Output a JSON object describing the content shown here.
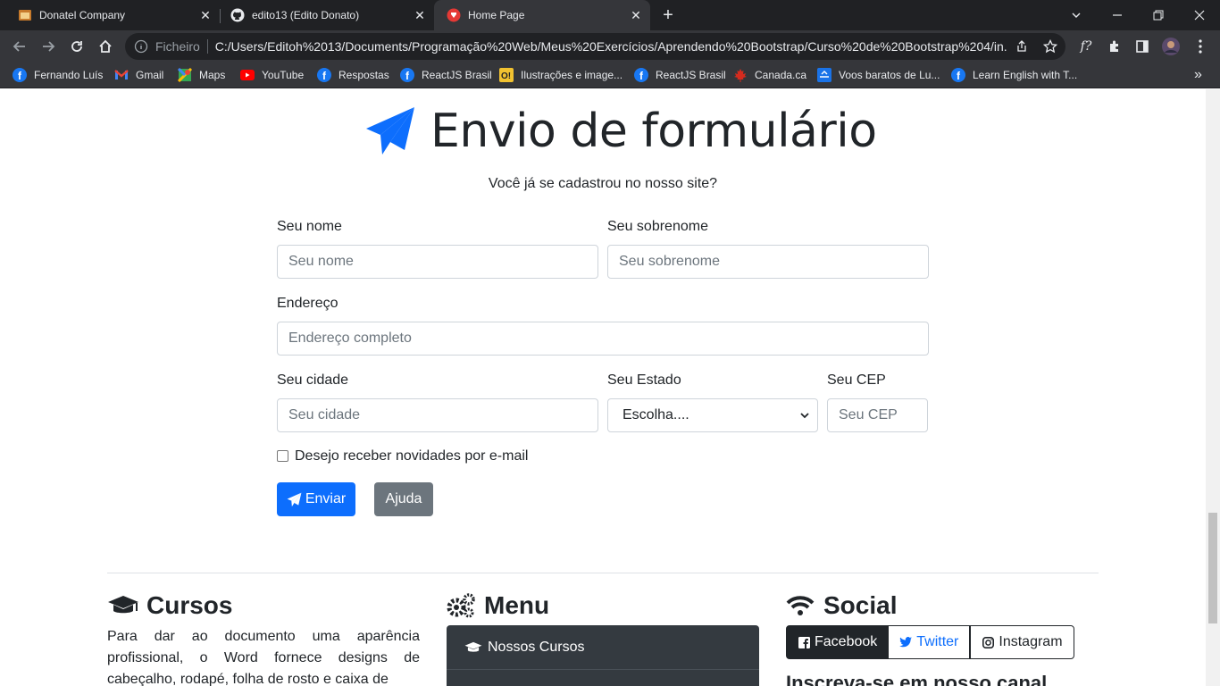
{
  "browser": {
    "tabs": [
      {
        "title": "Donatel Company",
        "icon": "folder-icon"
      },
      {
        "title": "edito13 (Edito Donato)",
        "icon": "github-icon"
      },
      {
        "title": "Home Page",
        "icon": "app-icon"
      }
    ],
    "address_scheme": "Ficheiro",
    "address_url": "C:/Users/Editoh%2013/Documents/Programação%20Web/Meus%20Exercícios/Aprendendo%20Bootstrap/Curso%20de%20Bootstrap%204/in...",
    "bookmarks": [
      {
        "label": "Fernando Luís",
        "icon": "facebook-icon"
      },
      {
        "label": "Gmail",
        "icon": "gmail-icon"
      },
      {
        "label": "Maps",
        "icon": "maps-icon"
      },
      {
        "label": "YouTube",
        "icon": "youtube-icon"
      },
      {
        "label": "Respostas",
        "icon": "facebook-icon"
      },
      {
        "label": "ReactJS Brasil",
        "icon": "facebook-icon"
      },
      {
        "label": "Ilustrações e image...",
        "icon": "image-icon"
      },
      {
        "label": "ReactJS Brasil",
        "icon": "facebook-icon"
      },
      {
        "label": "Canada.ca",
        "icon": "maple-leaf-icon"
      },
      {
        "label": "Voos baratos de Lu...",
        "icon": "plane-icon"
      },
      {
        "label": "Learn English with T...",
        "icon": "facebook-icon"
      }
    ],
    "more_bookmarks": "»"
  },
  "page": {
    "title": "Envio de formulário",
    "lead": "Você já se cadastrou no nosso site?",
    "form": {
      "nome_label": "Seu nome",
      "nome_placeholder": "Seu nome",
      "sobrenome_label": "Seu sobrenome",
      "sobrenome_placeholder": "Seu sobrenome",
      "endereco_label": "Endereço",
      "endereco_placeholder": "Endereço completo",
      "cidade_label": "Seu cidade",
      "cidade_placeholder": "Seu cidade",
      "estado_label": "Seu Estado",
      "estado_selected": "Escolha....",
      "cep_label": "Seu CEP",
      "cep_placeholder": "Seu CEP",
      "newsletter_label": "Desejo receber novidades por e-mail",
      "newsletter_checked": false,
      "submit_label": "Enviar",
      "help_label": "Ajuda"
    },
    "footer": {
      "cursos_title": "Cursos",
      "cursos_text": "Para dar ao documento uma aparência profissional, o Word fornece designs de cabeçalho, rodapé, folha de rosto e caixa de",
      "menu_title": "Menu",
      "menu_items": [
        "Nossos Cursos"
      ],
      "social_title": "Social",
      "social_buttons": [
        "Facebook",
        "Twitter",
        "Instagram"
      ],
      "social_text": "Inscreva-se em nosso canal..."
    }
  },
  "colors": {
    "primary": "#0d6efd",
    "secondary": "#6c757d",
    "dark": "#343a40",
    "text": "#212529"
  }
}
